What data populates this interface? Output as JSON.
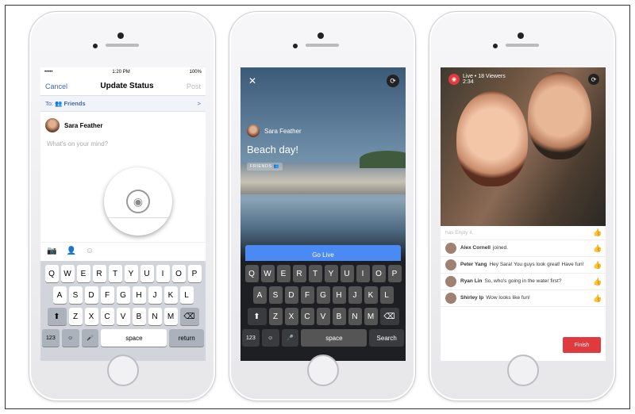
{
  "phone1": {
    "status": {
      "carrier": "••••• ",
      "time": "1:20 PM",
      "battery": "100%"
    },
    "nav": {
      "cancel": "Cancel",
      "title": "Update Status",
      "post": "Post"
    },
    "to": {
      "label": "To:",
      "audience": "Friends",
      "chevron": ">"
    },
    "user_name": "Sara Feather",
    "placeholder": "What's on your mind?",
    "keyboard": {
      "row1": [
        "Q",
        "W",
        "E",
        "R",
        "T",
        "Y",
        "U",
        "I",
        "O",
        "P"
      ],
      "row2": [
        "A",
        "S",
        "D",
        "F",
        "G",
        "H",
        "J",
        "K",
        "L"
      ],
      "row3": [
        "Z",
        "X",
        "C",
        "V",
        "B",
        "N",
        "M"
      ],
      "num": "123",
      "space": "space",
      "return": "return"
    }
  },
  "phone2": {
    "user_name": "Sara Feather",
    "title": "Beach day!",
    "audience": "FRIENDS",
    "go_live": "Go Live",
    "keyboard": {
      "row1": [
        "Q",
        "W",
        "E",
        "R",
        "T",
        "Y",
        "U",
        "I",
        "O",
        "P"
      ],
      "row2": [
        "A",
        "S",
        "D",
        "F",
        "G",
        "H",
        "J",
        "K",
        "L"
      ],
      "row3": [
        "Z",
        "X",
        "C",
        "V",
        "B",
        "N",
        "M"
      ],
      "num": "123",
      "space": "space",
      "search": "Search"
    }
  },
  "phone3": {
    "live": "Live",
    "viewers": "• 18 Viewers",
    "duration": "2:34",
    "comments": [
      {
        "name": "",
        "text": "has Enjoy it.",
        "faded": true,
        "liked": false
      },
      {
        "name": "Alex Cornell",
        "text": "joined.",
        "faded": false,
        "liked": false
      },
      {
        "name": "Peter Yang",
        "text": "Hey Sara! You guys look great! Have fun!",
        "faded": false,
        "liked": true
      },
      {
        "name": "Ryan Lin",
        "text": "So, who's going in the water first?",
        "faded": false,
        "liked": false
      },
      {
        "name": "Shirley Ip",
        "text": "Wow looks like fun!",
        "faded": false,
        "liked": false
      }
    ],
    "finish": "Finish"
  },
  "colors": {
    "facebook_blue": "#4267b2",
    "go_live_blue": "#4a8af4",
    "live_red": "#e0393e"
  }
}
